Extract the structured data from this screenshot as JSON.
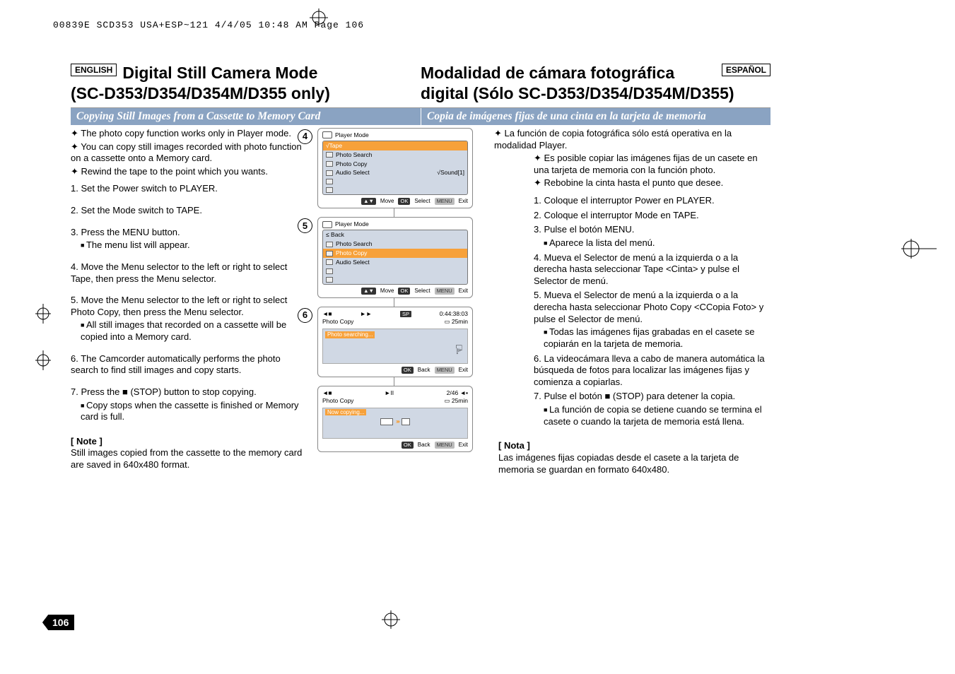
{
  "header_line": "00839E SCD353 USA+ESP~121  4/4/05 10:48 AM  Page 106",
  "page_number": "106",
  "left": {
    "lang": "ENGLISH",
    "title1": "Digital Still Camera Mode",
    "title2": "(SC-D353/D354/D354M/D355 only)",
    "section": "Copying Still Images from a Cassette to Memory Card",
    "intro": [
      "The photo copy function works only in Player mode.",
      "You can copy still images recorded with photo function on a cassette onto a Memory card.",
      "Rewind the tape to the point which you wants."
    ],
    "steps": [
      {
        "n": "1.",
        "t": "Set the Power switch to PLAYER.",
        "sub": []
      },
      {
        "n": "2.",
        "t": "Set the Mode switch to TAPE.",
        "sub": []
      },
      {
        "n": "3.",
        "t": "Press the MENU button.",
        "sub": [
          "The menu list will appear."
        ]
      },
      {
        "n": "4.",
        "t": "Move the Menu selector to the left or right to select Tape, then press the Menu selector.",
        "sub": []
      },
      {
        "n": "5.",
        "t": "Move the Menu selector to the left or right to select Photo Copy, then press the Menu selector.",
        "sub": [
          "All still images that recorded on a cassette will be copied into a Memory card."
        ]
      },
      {
        "n": "6.",
        "t": "The Camcorder automatically performs the photo search to find still images and copy starts.",
        "sub": []
      },
      {
        "n": "7.",
        "t": "Press the ■ (STOP) button to stop copying.",
        "sub": [
          "Copy stops when the cassette is finished or Memory card is full."
        ]
      }
    ],
    "note_head": "[ Note ]",
    "note_body": "Still images copied from the cassette to the memory card are saved in 640x480 format."
  },
  "right": {
    "lang": "ESPAÑOL",
    "title1": "Modalidad de cámara fotográfica",
    "title2": "digital (Sólo SC-D353/D354/D354M/D355)",
    "section": "Copia de imágenes fijas de una cinta en la tarjeta de memoria",
    "intro_top": "La función de copia fotográfica sólo está operativa en la modalidad Player.",
    "intro": [
      "Es posible copiar las imágenes fijas de un casete en una tarjeta de memoria con la función photo.",
      "Rebobine la cinta hasta el punto que desee."
    ],
    "steps": [
      {
        "n": "1.",
        "t": "Coloque el interruptor Power en PLAYER.",
        "sub": []
      },
      {
        "n": "2.",
        "t": "Coloque el interruptor Mode en TAPE.",
        "sub": []
      },
      {
        "n": "3.",
        "t": "Pulse el botón MENU.",
        "sub": [
          "Aparece la lista del menú."
        ]
      },
      {
        "n": "4.",
        "t": "Mueva el Selector de menú a la izquierda o a la derecha hasta seleccionar Tape <Cinta> y pulse el Selector de menú.",
        "sub": []
      },
      {
        "n": "5.",
        "t": "Mueva el Selector de menú a la izquierda o a la derecha hasta seleccionar Photo Copy <CCopia Foto> y pulse el Selector de menú.",
        "sub": [
          "Todas las imágenes fijas grabadas en el casete se copiarán en la tarjeta de memoria."
        ]
      },
      {
        "n": "6.",
        "t": "La videocámara lleva a cabo de manera automática la búsqueda de fotos para localizar las imágenes fijas y comienza a copiarlas.",
        "sub": []
      },
      {
        "n": "7.",
        "t": "Pulse el botón ■ (STOP) para detener la copia.",
        "sub": [
          "La función de copia se detiene cuando se termina el casete o cuando la tarjeta de memoria está llena."
        ]
      }
    ],
    "note_head": "[ Nota ]",
    "note_body": "Las imágenes fijas copiadas desde el casete a la tarjeta de memoria se guardan en formato 640x480."
  },
  "diagrams": {
    "circles": {
      "d4": "4",
      "d5": "5",
      "d6": "6"
    },
    "menu4": {
      "title": "Player Mode",
      "rows": [
        "√Tape",
        "Photo Search",
        "Photo Copy",
        "Audio Select"
      ],
      "aside": "√Sound[1]",
      "foot": [
        "Move",
        "Select",
        "Exit"
      ],
      "footkeys": [
        "▲▼",
        "OK",
        "MENU"
      ]
    },
    "menu5": {
      "title": "Player Mode",
      "rows": [
        "≤ Back",
        "Photo Search",
        "Photo Copy",
        "Audio Select"
      ],
      "hl_index": 2,
      "foot": [
        "Move",
        "Select",
        "Exit"
      ],
      "footkeys": [
        "▲▼",
        "OK",
        "MENU"
      ]
    },
    "screen6a": {
      "tl": "",
      "tr_badge": "SP",
      "tr_time": "0:44:38:03",
      "line2l": "Photo Copy",
      "line2r": "25min",
      "inner": "Photo searching...",
      "foot": [
        "Back",
        "Exit"
      ],
      "footkeys": [
        "OK",
        "MENU"
      ]
    },
    "screen6b": {
      "ctr": "►II",
      "tr": "2/46",
      "line2l": "Photo Copy",
      "line2r": "25min",
      "inner": "Now copying...",
      "foot": [
        "Back",
        "Exit"
      ],
      "footkeys": [
        "OK",
        "MENU"
      ]
    }
  }
}
